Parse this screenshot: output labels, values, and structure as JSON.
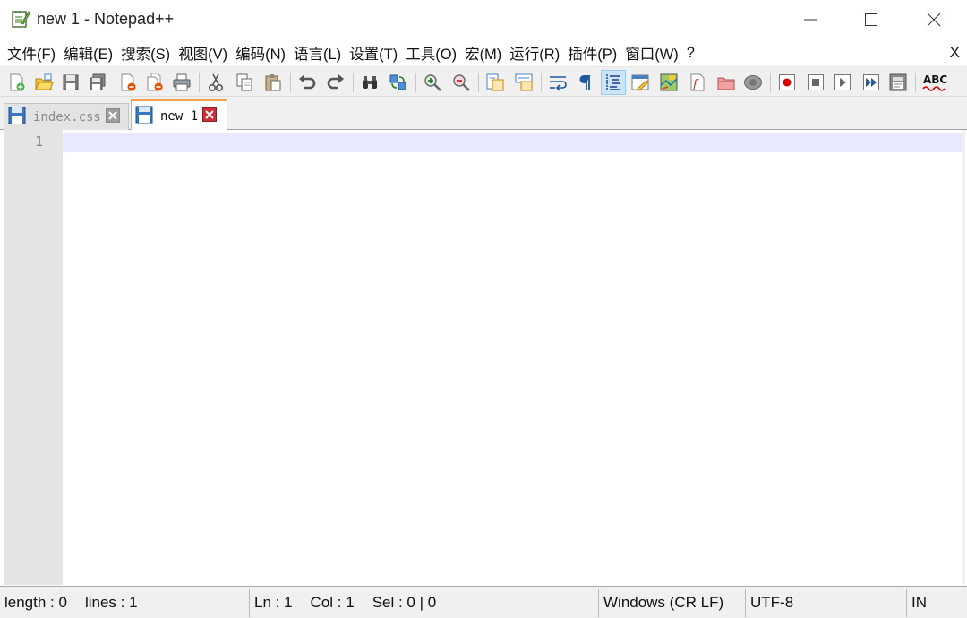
{
  "window": {
    "title": "new 1 - Notepad++",
    "minimize_icon": "minimize-icon",
    "maximize_icon": "maximize-icon",
    "close_icon": "close-icon"
  },
  "menu": {
    "items": [
      "文件(F)",
      "编辑(E)",
      "搜索(S)",
      "视图(V)",
      "编码(N)",
      "语言(L)",
      "设置(T)",
      "工具(O)",
      "宏(M)",
      "运行(R)",
      "插件(P)",
      "窗口(W)",
      "?"
    ],
    "close_label": "X"
  },
  "toolbar": {
    "spellcheck_label": "ABC",
    "buttons": [
      "new-file",
      "open-file",
      "save",
      "save-all",
      "close",
      "close-all",
      "print",
      "cut",
      "copy",
      "paste",
      "undo",
      "redo",
      "find",
      "replace",
      "zoom-in",
      "zoom-out",
      "sync-vertical",
      "sync-horizontal",
      "word-wrap",
      "show-all-chars",
      "indent-guide",
      "user-defined-language",
      "document-map",
      "function-list",
      "folder-as-workspace",
      "monitoring",
      "start-recording",
      "stop-recording",
      "playback",
      "run-macro-multiple",
      "save-macro",
      "spell-check"
    ]
  },
  "tabs": [
    {
      "label": "index.css",
      "active": false
    },
    {
      "label": "new 1",
      "active": true
    }
  ],
  "editor": {
    "line_numbers": [
      "1"
    ],
    "content": ""
  },
  "status": {
    "length": "length : 0",
    "lines": "lines : 1",
    "ln": "Ln : 1",
    "col": "Col : 1",
    "sel": "Sel : 0 | 0",
    "eol": "Windows (CR LF)",
    "encoding": "UTF-8",
    "mode": "IN"
  },
  "colors": {
    "current_line": "#e8e8ff",
    "gutter": "#e4e4e4",
    "active_tab_accent": "#f5a04b",
    "tab_close": "#c8303c"
  }
}
